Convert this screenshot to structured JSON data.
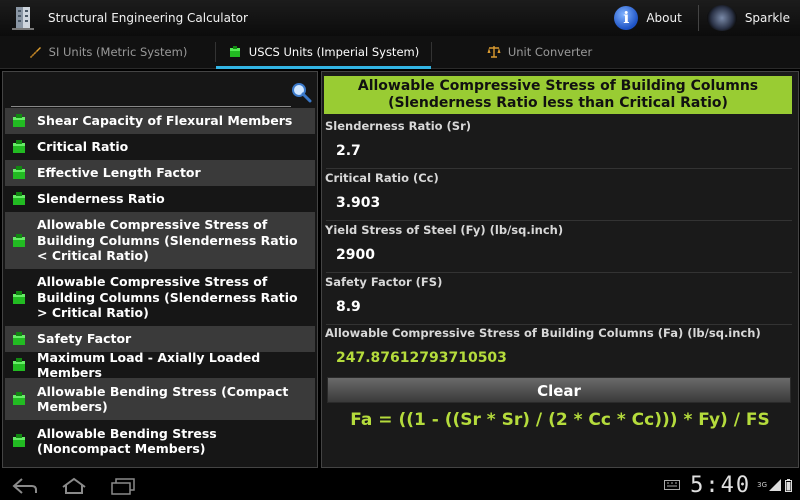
{
  "app": {
    "title": "Structural Engineering Calculator"
  },
  "actions": {
    "about": "About",
    "sparkle": "Sparkle"
  },
  "tabs": [
    {
      "label": "SI Units (Metric System)"
    },
    {
      "label": "USCS Units (Imperial System)"
    },
    {
      "label": "Unit Converter"
    }
  ],
  "search": {
    "value": "",
    "placeholder": ""
  },
  "list": [
    {
      "label": "Shear Capacity of Flexural Members"
    },
    {
      "label": "Critical Ratio"
    },
    {
      "label": "Effective Length Factor"
    },
    {
      "label": "Slenderness Ratio"
    },
    {
      "label": "Allowable Compressive Stress of Building Columns (Slenderness Ratio < Critical Ratio)"
    },
    {
      "label": "Allowable Compressive Stress of Building Columns (Slenderness Ratio > Critical Ratio)"
    },
    {
      "label": "Safety Factor"
    },
    {
      "label": "Maximum Load - Axially Loaded Members"
    },
    {
      "label": "Allowable Bending Stress (Compact Members)"
    },
    {
      "label": "Allowable Bending Stress (Noncompact Members)"
    }
  ],
  "calculator": {
    "title_line1": "Allowable Compressive Stress of Building Columns",
    "title_line2": "(Slenderness Ratio less than Critical Ratio)",
    "fields": [
      {
        "label": "Slenderness Ratio (Sr)",
        "value": "2.7"
      },
      {
        "label": "Critical Ratio (Cc)",
        "value": "3.903"
      },
      {
        "label": "Yield Stress of Steel (Fy) (lb/sq.inch)",
        "value": "2900"
      },
      {
        "label": "Safety Factor (FS)",
        "value": "8.9"
      }
    ],
    "result": {
      "label": "Allowable Compressive Stress of Building Columns (Fa) (lb/sq.inch)",
      "value": "247.87612793710503"
    },
    "clear_label": "Clear",
    "formula": "Fa = ((1 - ((Sr * Sr) / (2 * Cc * Cc))) * Fy) / FS"
  },
  "status": {
    "clock": "5:40",
    "network": "3G"
  },
  "colors": {
    "accent": "#33b5e5",
    "title_bar": "#99cc33",
    "result": "#b5dc3c"
  }
}
